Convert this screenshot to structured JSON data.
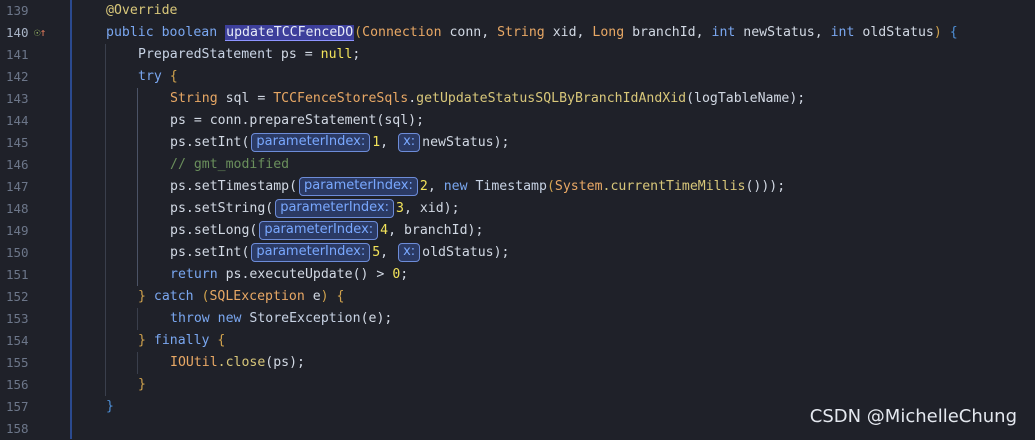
{
  "editor": {
    "line_numbers": [
      "139",
      "140",
      "141",
      "142",
      "143",
      "144",
      "145",
      "146",
      "147",
      "148",
      "149",
      "150",
      "151",
      "152",
      "153",
      "154",
      "155",
      "156",
      "157",
      "158"
    ],
    "gutter_icons": [
      "override-marker-icon",
      "implemented-up-arrow-icon"
    ],
    "tokens": {
      "l139_annotation": "@Override",
      "l140_public": "public",
      "l140_boolean": "boolean",
      "l140_method": "updateTCCFenceDO",
      "l140_paren": "(",
      "l140_t1": "Connection",
      "l140_p1": " conn, ",
      "l140_t2": "String",
      "l140_p2": " xid, ",
      "l140_t3": "Long",
      "l140_p3": " branchId, ",
      "l140_t4": "int",
      "l140_p4": " newStatus, ",
      "l140_t5": "int",
      "l140_p5": " oldStatus",
      "l140_close": ")",
      "l140_brace": "{",
      "l141_type": "PreparedStatement",
      "l141_rest": " ps = ",
      "l141_null": "null",
      "l141_semi": ";",
      "l142_try": "try",
      "l142_brace": "{",
      "l143_type": "String",
      "l143_var": " sql = ",
      "l143_cls": "TCCFenceStoreSqls",
      "l143_dot": ".",
      "l143_fn": "getUpdateStatusSQLByBranchIdAndXid",
      "l143_args": "(logTableName);",
      "l144_text": "ps = conn.prepareStatement(sql);",
      "l145_call": "ps.setInt(",
      "l145_hint1": "parameterIndex:",
      "l145_num": "1",
      "l145_comma": ",",
      "l145_hint2": "x:",
      "l145_tail": "newStatus);",
      "l146_comment": "// gmt_modified",
      "l147_call": "ps.setTimestamp(",
      "l147_hint1": "parameterIndex:",
      "l147_num": "2",
      "l147_comma": ", ",
      "l147_new": "new",
      "l147_cls": " Timestamp",
      "l147_open": "(",
      "l147_sys": "System",
      "l147_fn": ".currentTimeMillis",
      "l147_close": "()));",
      "l148_call": "ps.setString(",
      "l148_hint1": "parameterIndex:",
      "l148_num": "3",
      "l148_tail": ", xid);",
      "l149_call": "ps.setLong(",
      "l149_hint1": "parameterIndex:",
      "l149_num": "4",
      "l149_tail": ", branchId);",
      "l150_call": "ps.setInt(",
      "l150_hint1": "parameterIndex:",
      "l150_num": "5",
      "l150_comma": ",",
      "l150_hint2": "x:",
      "l150_tail": "oldStatus);",
      "l151_return": "return",
      "l151_rest": " ps.executeUpdate() > ",
      "l151_num": "0",
      "l151_semi": ";",
      "l152_close": "}",
      "l152_catch": " catch ",
      "l152_open": "(",
      "l152_type": "SQLException",
      "l152_var": " e",
      "l152_close2": ")",
      "l152_brace": " {",
      "l153_throw": "throw",
      "l153_new": " new ",
      "l153_cls": "StoreException",
      "l153_arg": "(e);",
      "l154_close": "}",
      "l154_finally": " finally ",
      "l154_brace": "{",
      "l155_cls": "IOUtil",
      "l155_fn": ".close",
      "l155_arg": "(ps);",
      "l156_brace": "}",
      "l157_brace": "}"
    }
  },
  "watermark": "CSDN @MichelleChung",
  "colors": {
    "background": "#1f2129",
    "keyword": "#7aa7f0",
    "type": "#e8a865",
    "highlight": "#3d3f9b",
    "hint": "#79a8ff",
    "number": "#f2e35a",
    "comment": "#6a8f5c",
    "gutter_separator": "#2b4a8f"
  }
}
